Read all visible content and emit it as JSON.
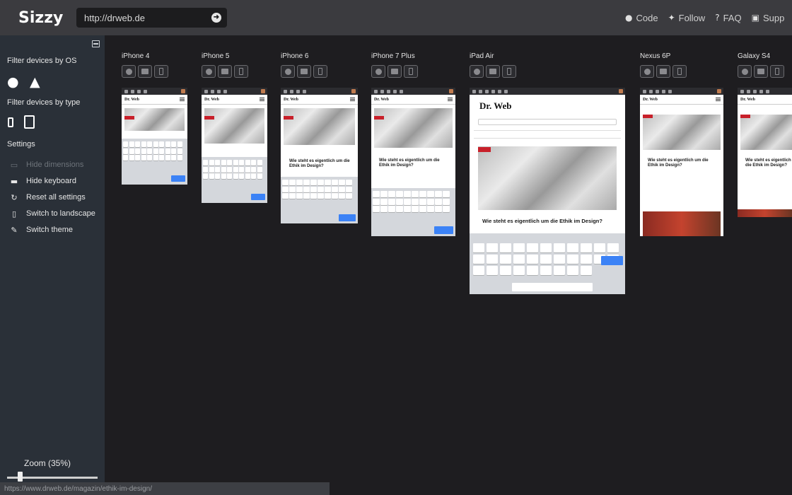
{
  "app": {
    "title": "Sizzy"
  },
  "url_bar": {
    "value": "http://drweb.de",
    "go_icon": "arrow-right-circle-icon"
  },
  "top_links": [
    {
      "label": "Code",
      "icon": "github-icon"
    },
    {
      "label": "Follow",
      "icon": "twitter-icon"
    },
    {
      "label": "FAQ",
      "icon": "question-circle-icon"
    },
    {
      "label": "Supp",
      "icon": "support-icon"
    }
  ],
  "sidebar": {
    "filter_os_label": "Filter devices by OS",
    "filter_type_label": "Filter devices by type",
    "settings_label": "Settings",
    "settings": [
      {
        "label": "Hide dimensions",
        "icon": "monitor-icon",
        "enabled": false
      },
      {
        "label": "Hide keyboard",
        "icon": "keyboard-icon",
        "enabled": true
      },
      {
        "label": "Reset all settings",
        "icon": "reset-icon",
        "enabled": true
      },
      {
        "label": "Switch to landscape",
        "icon": "phone-icon",
        "enabled": true
      },
      {
        "label": "Switch theme",
        "icon": "brush-icon",
        "enabled": true
      }
    ],
    "zoom_label": "Zoom  (35%)",
    "zoom_value": 0.35
  },
  "status_url": "https://www.drweb.de/magazin/ethik-im-design/",
  "devices": [
    {
      "name": "iPhone 4"
    },
    {
      "name": "iPhone 5"
    },
    {
      "name": "iPhone 6"
    },
    {
      "name": "iPhone 7 Plus"
    },
    {
      "name": "iPad Air"
    },
    {
      "name": "Nexus 6P"
    },
    {
      "name": "Galaxy S4"
    }
  ],
  "site": {
    "logo": "Dr. Web",
    "article_title": "Wie steht es eigentlich um die Ethik im Design?",
    "search_key": "Search"
  },
  "colors": {
    "topbar": "#3b3b3f",
    "sidebar": "#2a3038",
    "canvas": "#1e1d20",
    "brand_red": "#c8202a",
    "keyboard_blue": "#3b82f6"
  }
}
